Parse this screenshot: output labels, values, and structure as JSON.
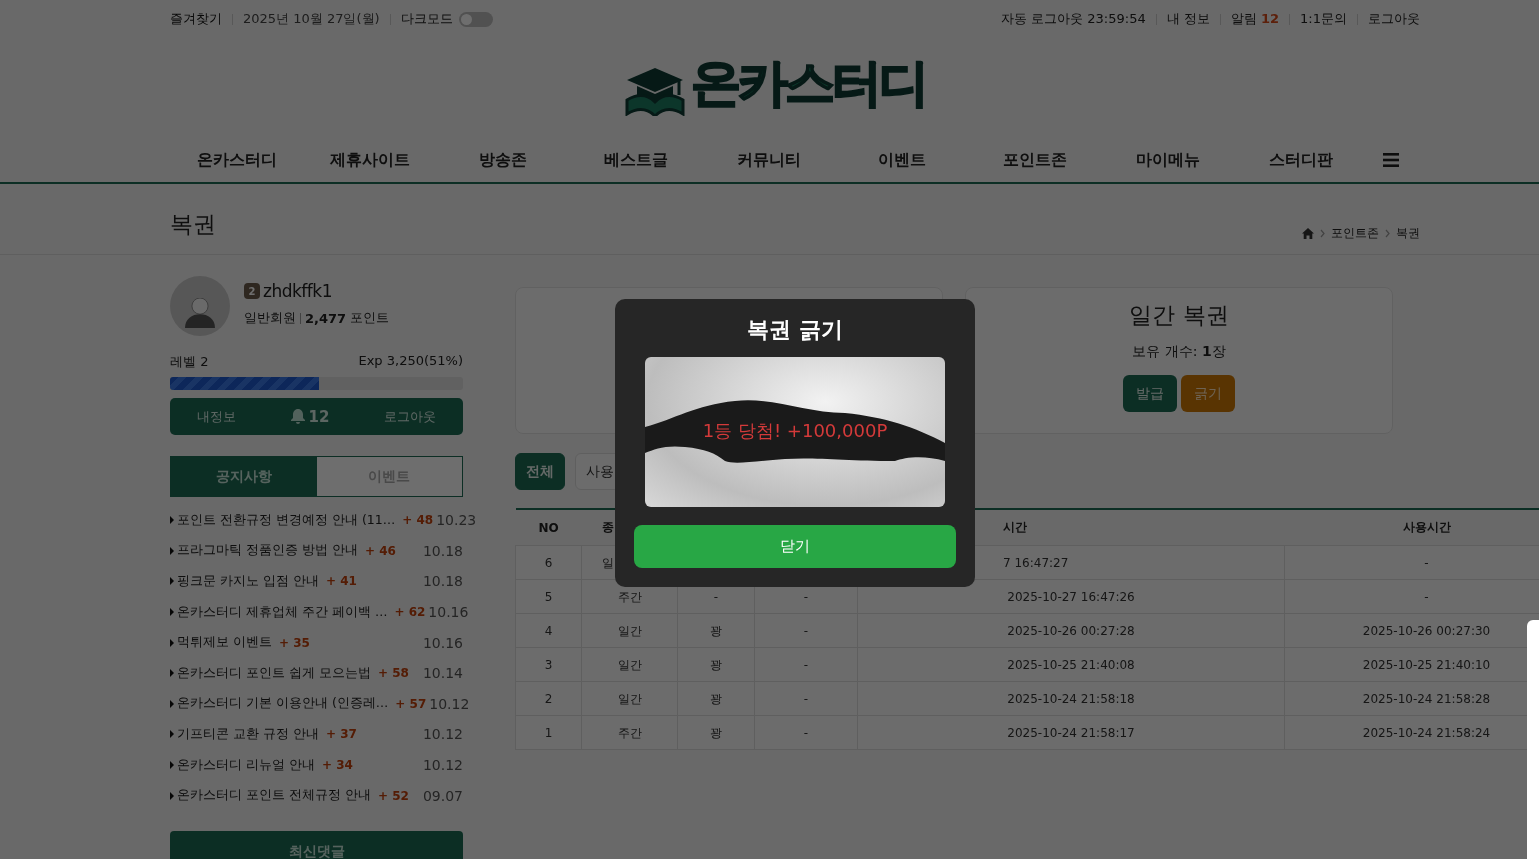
{
  "top_bar": {
    "left": [
      {
        "kind": "link",
        "text": "즐겨찾기"
      },
      {
        "kind": "date",
        "text": "2025년 10월 27일(월)"
      }
    ],
    "dark_mode": {
      "label": "다크모드",
      "on": false
    },
    "right": [
      {
        "kind": "text",
        "text": "자동 로그아웃 23:59:54"
      },
      {
        "kind": "link",
        "text": "내 정보"
      },
      {
        "kind": "alarm",
        "text": "알림",
        "count": "12"
      },
      {
        "kind": "link",
        "text": "1:1문의"
      },
      {
        "kind": "link",
        "text": "로그아웃"
      }
    ]
  },
  "logo": {
    "text": "온카스터디"
  },
  "nav": {
    "items": [
      "온카스터디",
      "제휴사이트",
      "방송존",
      "베스트글",
      "커뮤니티",
      "이벤트",
      "포인트존",
      "마이메뉴",
      "스터디판"
    ]
  },
  "page_header": {
    "title": "복권",
    "breadcrumb": [
      "포인트존",
      "복권"
    ]
  },
  "profile": {
    "level_badge": "2",
    "username": "zhdkffk1",
    "grade": "일반회원",
    "points": "2,477",
    "points_unit": "포인트",
    "level_label": "레벨 2",
    "exp": "Exp 3,250(51%)",
    "level": 0.51,
    "actions": [
      {
        "kind": "text",
        "text": "내정보"
      },
      {
        "kind": "bell",
        "text": "12"
      },
      {
        "kind": "text",
        "text": "로그아웃"
      }
    ]
  },
  "notice_tabs": [
    {
      "label": "공지사항",
      "selected": true
    },
    {
      "label": "이벤트",
      "selected": false
    }
  ],
  "notices": [
    {
      "title": "포인트 전환규정 변경예정 안내 (11…",
      "points": "+ 48",
      "date": "10.23"
    },
    {
      "title": "프라그마틱 정품인증 방법 안내",
      "points": "+ 46",
      "date": "10.18"
    },
    {
      "title": "핑크문 카지노 입점 안내",
      "points": "+ 41",
      "date": "10.18"
    },
    {
      "title": "온카스터디 제휴업체 주간 페이백 …",
      "points": "+ 62",
      "date": "10.16"
    },
    {
      "title": "먹튀제보 이벤트",
      "points": "+ 35",
      "date": "10.16"
    },
    {
      "title": "온카스터디 포인트 쉽게 모으는법",
      "points": "+ 58",
      "date": "10.14"
    },
    {
      "title": "온카스터디 기본 이용안내 (인증레…",
      "points": "+ 57",
      "date": "10.12"
    },
    {
      "title": "기프티콘 교환 규정 안내",
      "points": "+ 37",
      "date": "10.12"
    },
    {
      "title": "온카스터디 리뉴얼 안내",
      "points": "+ 34",
      "date": "10.12"
    },
    {
      "title": "온카스터디 포인트 전체규정 안내",
      "points": "+ 52",
      "date": "09.07"
    }
  ],
  "latest_comments": {
    "title": "최신댓글"
  },
  "daily_lottery": {
    "title": "일간 복권",
    "owned": "보유 개수: **1**장",
    "buttons": [
      {
        "kind": "issue",
        "label": "발급"
      },
      {
        "kind": "scratch",
        "label": "긁기"
      }
    ]
  },
  "filter_tabs": [
    {
      "label": "전체",
      "selected": true
    },
    {
      "label": "사용",
      "selected": false
    }
  ],
  "table": {
    "columns": [
      {
        "label": "NO"
      },
      {
        "label": "종"
      },
      {},
      {},
      {
        "label": "시간"
      },
      {
        "label": "사용시간"
      }
    ],
    "rows": [
      {
        "cells": [
          "6",
          "일",
          null,
          null,
          "7 16:47:27",
          "-"
        ]
      },
      {
        "cells": [
          "5",
          "주간",
          "-",
          "-",
          "2025-10-27 16:47:26",
          "-"
        ]
      },
      {
        "cells": [
          "4",
          "일간",
          "꽝",
          "-",
          "2025-10-26 00:27:28",
          "2025-10-26 00:27:30"
        ]
      },
      {
        "cells": [
          "3",
          "일간",
          "꽝",
          "-",
          "2025-10-25 21:40:08",
          "2025-10-25 21:40:10"
        ]
      },
      {
        "cells": [
          "2",
          "일간",
          "꽝",
          "-",
          "2025-10-24 21:58:18",
          "2025-10-24 21:58:28"
        ]
      },
      {
        "cells": [
          "1",
          "주간",
          "꽝",
          "-",
          "2025-10-24 21:58:17",
          "2025-10-24 21:58:24"
        ]
      }
    ]
  },
  "modal": {
    "title": "복권 긁기",
    "prize": "1등 당첨! +100,000P",
    "button": "닫기"
  }
}
